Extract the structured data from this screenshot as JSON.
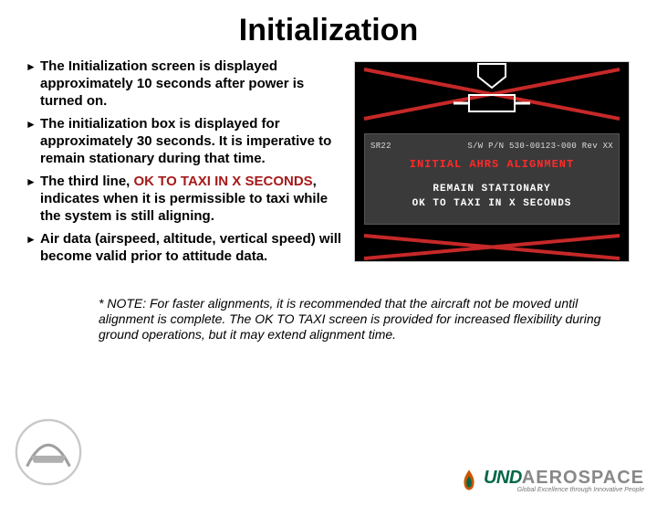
{
  "title": "Initialization",
  "bullets": [
    {
      "prefix": "The Initialization screen is displayed approximately 10 seconds after power is turned on.",
      "highlight": "",
      "suffix": ""
    },
    {
      "prefix": "The initialization box is displayed for approximately 30 seconds. It is imperative to remain stationary during that time.",
      "highlight": "",
      "suffix": ""
    },
    {
      "prefix": "The third line, ",
      "highlight": "OK TO TAXI IN X SECONDS",
      "suffix": ", indicates when it is permissible to taxi while the system is still aligning."
    },
    {
      "prefix": "Air data (airspeed, altitude, vertical speed) will become valid prior to attitude data.",
      "highlight": "",
      "suffix": ""
    }
  ],
  "pfd": {
    "model": "SR22",
    "sw": "S/W P/N 530-00123-000 Rev XX",
    "line1": "INITIAL AHRS ALIGNMENT",
    "line2": "REMAIN STATIONARY",
    "line3": "OK TO TAXI IN X SECONDS"
  },
  "note": "* NOTE:  For faster alignments, it is recommended that the aircraft not be moved until alignment is complete.  The OK TO TAXI screen is provided for increased flexibility during ground operations, but it may extend alignment time.",
  "brand": {
    "left": "UND",
    "right": "AEROSPACE",
    "tagline": "Global Excellence through Innovative People"
  }
}
